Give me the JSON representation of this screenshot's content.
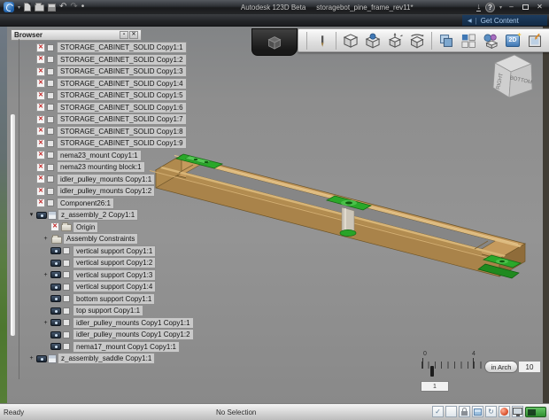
{
  "window": {
    "app_title": "Autodesk 123D Beta",
    "doc_title": "storagebot_pine_frame_rev11*"
  },
  "icons": {
    "caret": "▾",
    "undo": "↶",
    "redo": "↷",
    "more": "•",
    "transfer": "↓",
    "help": "?",
    "minimize": "–",
    "close": "✕",
    "collapse_left": "◀",
    "pipe": "|",
    "expander_open": "▾",
    "expander_plus": "+",
    "broken": "✕",
    "panel_btn1": "▪",
    "panel_btn2": "✕",
    "check": "✓",
    "sync": "↻",
    "sketch2d": "2D"
  },
  "subbar": {
    "get_content_label": "Get Content"
  },
  "browser": {
    "title": "Browser",
    "items": [
      {
        "label": "STORAGE_CABINET_SOLID Copy1:1",
        "indent": 0,
        "icon": "redx",
        "checkbox": true
      },
      {
        "label": "STORAGE_CABINET_SOLID Copy1:2",
        "indent": 0,
        "icon": "redx",
        "checkbox": true
      },
      {
        "label": "STORAGE_CABINET_SOLID Copy1:3",
        "indent": 0,
        "icon": "redx",
        "checkbox": true
      },
      {
        "label": "STORAGE_CABINET_SOLID Copy1:4",
        "indent": 0,
        "icon": "redx",
        "checkbox": true
      },
      {
        "label": "STORAGE_CABINET_SOLID Copy1:5",
        "indent": 0,
        "icon": "redx",
        "checkbox": true
      },
      {
        "label": "STORAGE_CABINET_SOLID Copy1:6",
        "indent": 0,
        "icon": "redx",
        "checkbox": true
      },
      {
        "label": "STORAGE_CABINET_SOLID Copy1:7",
        "indent": 0,
        "icon": "redx",
        "checkbox": true
      },
      {
        "label": "STORAGE_CABINET_SOLID Copy1:8",
        "indent": 0,
        "icon": "redx",
        "checkbox": true
      },
      {
        "label": "STORAGE_CABINET_SOLID Copy1:9",
        "indent": 0,
        "icon": "redx",
        "checkbox": true
      },
      {
        "label": "nema23_mount Copy1:1",
        "indent": 0,
        "icon": "redx",
        "checkbox": true
      },
      {
        "label": "nema23 mounting block:1",
        "indent": 0,
        "icon": "redx",
        "checkbox": true
      },
      {
        "label": "idler_pulley_mounts Copy1:1",
        "indent": 0,
        "icon": "redx",
        "checkbox": true
      },
      {
        "label": "idler_pulley_mounts Copy1:2",
        "indent": 0,
        "icon": "redx",
        "checkbox": true
      },
      {
        "label": "Component26:1",
        "indent": 0,
        "icon": "redx",
        "checkbox": true
      },
      {
        "label": "z_assembly_2 Copy1:1",
        "indent": 0,
        "icon": "eye",
        "assembly": true,
        "expand": "open"
      },
      {
        "label": "Origin",
        "indent": 1,
        "icon": "redx",
        "folder": true
      },
      {
        "label": "Assembly Constraints",
        "indent": 1,
        "folder": true,
        "expand": "plus"
      },
      {
        "label": "vertical support Copy1:1",
        "indent": 1,
        "icon": "eye",
        "checkbox": true
      },
      {
        "label": "vertical support Copy1:2",
        "indent": 1,
        "icon": "eye",
        "checkbox": true
      },
      {
        "label": "vertical support Copy1:3",
        "indent": 1,
        "icon": "eye",
        "checkbox": true,
        "expand": "plus"
      },
      {
        "label": "vertical support Copy1:4",
        "indent": 1,
        "icon": "eye",
        "checkbox": true
      },
      {
        "label": "bottom support Copy1:1",
        "indent": 1,
        "icon": "eye",
        "checkbox": true
      },
      {
        "label": "top support Copy1:1",
        "indent": 1,
        "icon": "eye",
        "checkbox": true
      },
      {
        "label": "idler_pulley_mounts Copy1 Copy1:1",
        "indent": 1,
        "icon": "eye",
        "checkbox": true,
        "expand": "plus"
      },
      {
        "label": "idler_pulley_mounts Copy1 Copy1:2",
        "indent": 1,
        "icon": "eye",
        "checkbox": true
      },
      {
        "label": "nema17_mount Copy1 Copy1:1",
        "indent": 1,
        "icon": "eye",
        "checkbox": true
      },
      {
        "label": "z_assembly_saddle Copy1:1",
        "indent": 0,
        "icon": "eye",
        "assembly": true,
        "expand": "plus"
      }
    ]
  },
  "viewport": {
    "viewcube": {
      "left_face": "RIGHT",
      "right_face": "BOTTOM"
    },
    "scale": {
      "tick_label_start": "0",
      "tick_label_mid": "4",
      "value_box": "1",
      "units_button": "in Arch",
      "grid_size": "10"
    }
  },
  "statusbar": {
    "left": "Ready",
    "center": "No Selection"
  },
  "colors": {
    "wood_top": "#c59a5d",
    "wood_trim": "#ddbb80",
    "wood_side": "#a9834a",
    "part_green": "#2aa82a",
    "viewport_bg": "#8e8e8e",
    "get_content_bg": "#12293f"
  }
}
